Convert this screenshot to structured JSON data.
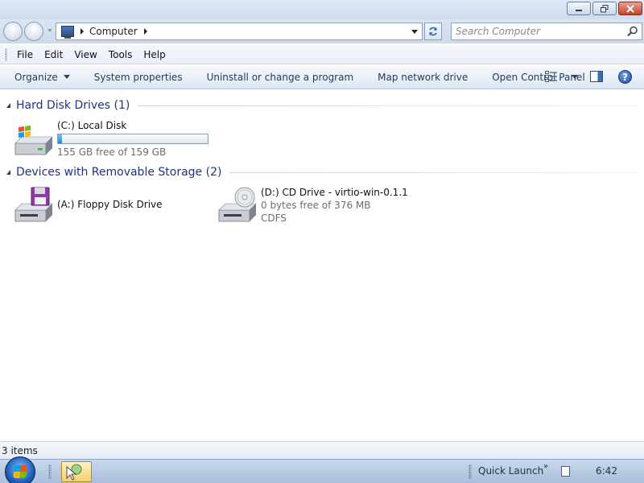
{
  "window": {
    "minimize_label": "minimize",
    "restore_label": "restore",
    "close_label": "close"
  },
  "address": {
    "location": "Computer",
    "search_placeholder": "Search Computer"
  },
  "menu": {
    "items": [
      {
        "label": "File"
      },
      {
        "label": "Edit"
      },
      {
        "label": "View"
      },
      {
        "label": "Tools"
      },
      {
        "label": "Help"
      }
    ]
  },
  "commands": {
    "organize": "Organize",
    "system_properties": "System properties",
    "uninstall": "Uninstall or change a program",
    "map_drive": "Map network drive",
    "control_panel": "Open Control Panel",
    "help": "?"
  },
  "groups": {
    "hard_disks": {
      "title": "Hard Disk Drives (1)",
      "drives": [
        {
          "name": "(C:) Local Disk",
          "free_text": "155 GB free of 159 GB",
          "used_fraction": 0.025,
          "icon": "hard-drive-icon"
        }
      ]
    },
    "removable": {
      "title": "Devices with Removable Storage (2)",
      "drives": [
        {
          "name": "(A:) Floppy Disk Drive",
          "icon": "floppy-drive-icon"
        },
        {
          "name": "(D:) CD Drive - virtio-win-0.1.1",
          "free_text": "0 bytes free of 376 MB",
          "filesystem": "CDFS",
          "icon": "cd-drive-icon"
        }
      ]
    }
  },
  "status": {
    "items_count": "3 items"
  },
  "taskbar": {
    "quick_launch": "Quick Launch",
    "chevron": "»",
    "clock": "6:42"
  },
  "colors": {
    "group_title": "#1e3287",
    "capacity_fill": "#1a8bcf"
  }
}
